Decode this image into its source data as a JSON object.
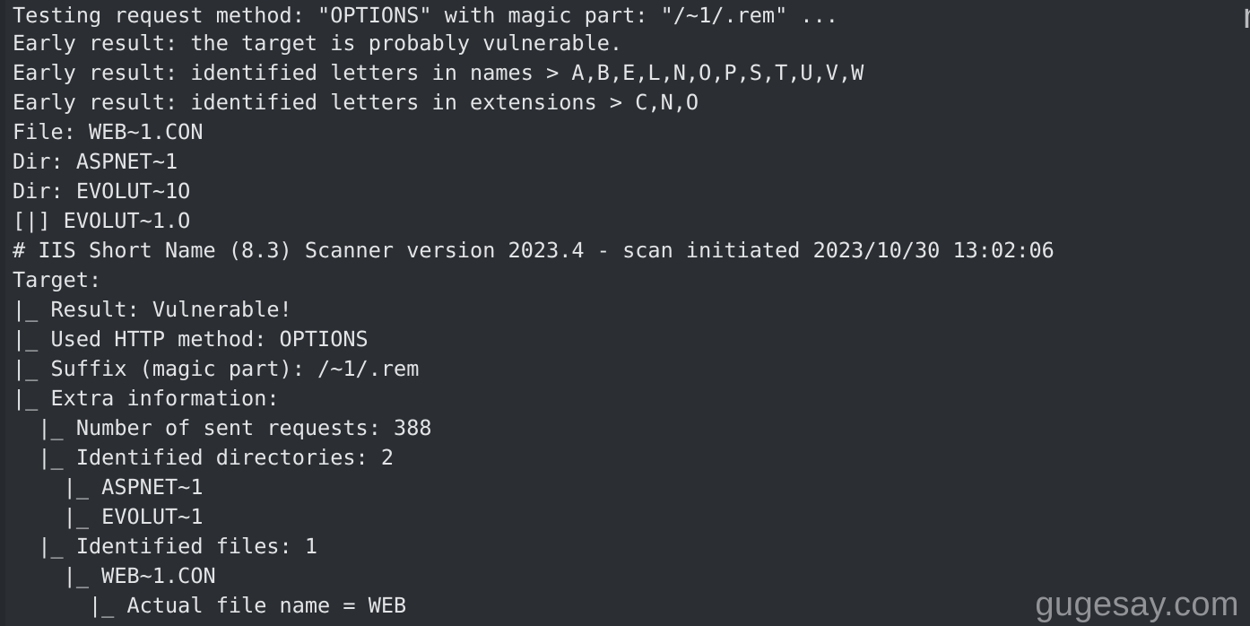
{
  "terminal": {
    "background_color": "#2b2e33",
    "text_color": "#e2e4e6",
    "lines": [
      "Testing request method: \"OPTIONS\" with magic part: \"/~1/.rem\" ...",
      "Early result: the target is probably vulnerable.",
      "Early result: identified letters in names > A,B,E,L,N,O,P,S,T,U,V,W",
      "Early result: identified letters in extensions > C,N,O",
      "File: WEB~1.CON",
      "Dir: ASPNET~1",
      "Dir: EVOLUT~1O",
      "[|] EVOLUT~1.O",
      "# IIS Short Name (8.3) Scanner version 2023.4 - scan initiated 2023/10/30 13:02:06",
      "Target:",
      "|_ Result: Vulnerable!",
      "|_ Used HTTP method: OPTIONS",
      "|_ Suffix (magic part): /~1/.rem",
      "|_ Extra information:",
      "  |_ Number of sent requests: 388",
      "  |_ Identified directories: 2",
      "    |_ ASPNET~1",
      "    |_ EVOLUT~1",
      "  |_ Identified files: 1",
      "    |_ WEB~1.CON",
      "      |_ Actual file name = WEB"
    ]
  },
  "scan": {
    "tool_name": "IIS Short Name (8.3) Scanner",
    "version": "2023.4",
    "initiated_date": "2023/10/30",
    "initiated_time": "13:02:06",
    "http_method": "OPTIONS",
    "magic_part": "/~1/.rem",
    "result": "Vulnerable!",
    "requests_sent": "388",
    "identified_directories_count": "2",
    "identified_directories": [
      "ASPNET~1",
      "EVOLUT~1"
    ],
    "identified_files_count": "1",
    "identified_files": [
      "WEB~1.CON"
    ],
    "actual_file_name": "WEB",
    "letters_in_names": "A,B,E,L,N,O,P,S,T,U,V,W",
    "letters_in_extensions": "C,N,O",
    "early_result": "the target is probably vulnerable."
  },
  "watermark": {
    "text": "gugesay.com",
    "color": "#9a9ca0"
  },
  "edge_glyph": {
    "text": "m"
  }
}
